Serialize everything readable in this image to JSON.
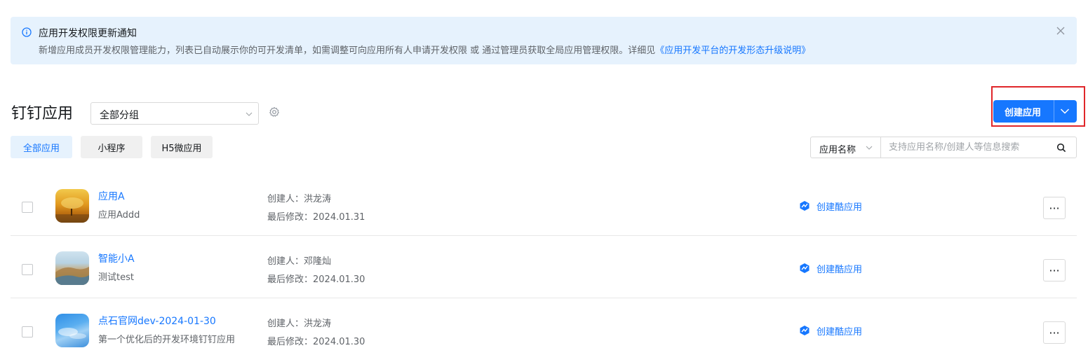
{
  "notice": {
    "title": "应用开发权限更新通知",
    "description": "新增应用成员开发权限管理能力，列表已自动展示你的可开发清单，如需调整可向应用所有人申请开发权限 或 通过管理员获取全局应用管理权限。详细见",
    "link_text": "《应用开发平台的开发形态升级说明》",
    "icons": {
      "info": "info-icon",
      "close": "close-icon"
    }
  },
  "header": {
    "title": "钉钉应用",
    "group_select_value": "全部分组",
    "create_button_label": "创建应用"
  },
  "tabs": [
    {
      "label": "全部应用",
      "active": true
    },
    {
      "label": "小程序",
      "active": false
    },
    {
      "label": "H5微应用",
      "active": false
    }
  ],
  "search": {
    "field_value": "应用名称",
    "placeholder": "支持应用名称/创建人等信息搜索"
  },
  "apps": [
    {
      "name": "应用A",
      "description": "应用Addd",
      "creator": "创建人：洪龙涛",
      "modified": "最后修改：2024.01.31",
      "action": "创建酷应用",
      "more": "···"
    },
    {
      "name": "智能小A",
      "description": "测试test",
      "creator": "创建人：邓隆灿",
      "modified": "最后修改：2024.01.30",
      "action": "创建酷应用",
      "more": "···"
    },
    {
      "name": "点石官网dev-2024-01-30",
      "description": "第一个优化后的开发环境钉钉应用",
      "creator": "创建人：洪龙涛",
      "modified": "最后修改：2024.01.30",
      "action": "创建酷应用",
      "more": "···"
    }
  ],
  "colors": {
    "accent": "#1677ff",
    "banner_bg": "#e6f2fd",
    "highlight_box": "#e0262a"
  }
}
